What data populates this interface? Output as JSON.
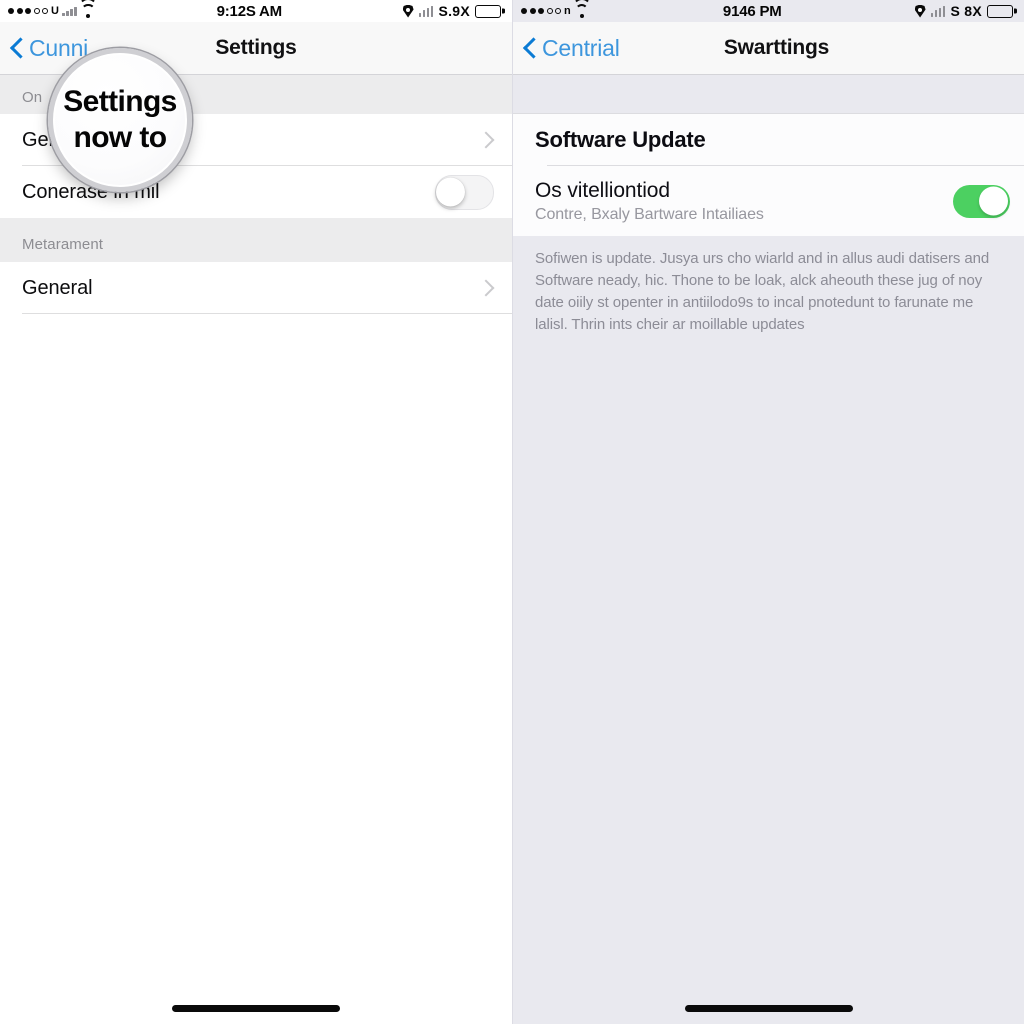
{
  "left_phone": {
    "status_bar": {
      "carrier_dots": "•••oo",
      "carrier_glyph": "U",
      "signal_icon": "cellular-signal-icon",
      "wifi_icon": "wifi-icon",
      "time": "9:12S AM",
      "location_icon": "location-arrow-icon",
      "bars_icon": "signal-bars-icon",
      "right_text": "S.9X",
      "battery_icon": "battery-full-icon"
    },
    "nav": {
      "back_icon": "chevron-left-icon",
      "back_label": "Cunni",
      "title": "Settings"
    },
    "sections": [
      {
        "header": "On",
        "rows": [
          {
            "label": "Ger",
            "accessory": "chevron",
            "accessory_icon": "chevron-right-icon"
          },
          {
            "label": "Conerase in mil",
            "accessory": "switch",
            "switch_state": "off"
          }
        ]
      },
      {
        "header": "Metarament",
        "rows": [
          {
            "label": "General",
            "accessory": "chevron",
            "accessory_icon": "chevron-right-icon"
          }
        ]
      }
    ],
    "home_indicator": "home-indicator"
  },
  "magnifier": {
    "icon": "magnifier-loupe",
    "line1": "Settings",
    "line2": "now to"
  },
  "right_phone": {
    "status_bar": {
      "carrier_dots": "•••oo",
      "carrier_glyph": "n",
      "wifi_icon": "wifi-icon",
      "time": "9146 PM",
      "location_icon": "location-arrow-icon",
      "bars_icon": "signal-bars-icon",
      "right_text": "S 8X",
      "battery_icon": "battery-full-icon"
    },
    "nav": {
      "back_icon": "chevron-left-icon",
      "back_label": "Centrial",
      "title": "Swarttings"
    },
    "section_title": "Software Update",
    "detail_row": {
      "title": "Os vitelliontiod",
      "subtitle": "Contre, Bxaly Bartware Intailiaes",
      "switch_state": "on",
      "switch_color": "#4cd061"
    },
    "footnote": "Sofiwen is updatе. Jusyа urs cho wiarld and in allus audi datisers and Software neady, hic. Thone to be loak, alck aheouth these jug of noy date oiily st openter in antiilodo9s to incal pnotedunt to farunate me lalisl. Thrin ints cheir ar moillable updates",
    "home_indicator": "home-indicator"
  },
  "colors": {
    "accent_blue": "#3d96dd",
    "switch_green": "#4cd061",
    "panel_grey": "#e9e9ef",
    "nav_grey": "#f8f8f8",
    "header_text": "#8d8d92"
  }
}
